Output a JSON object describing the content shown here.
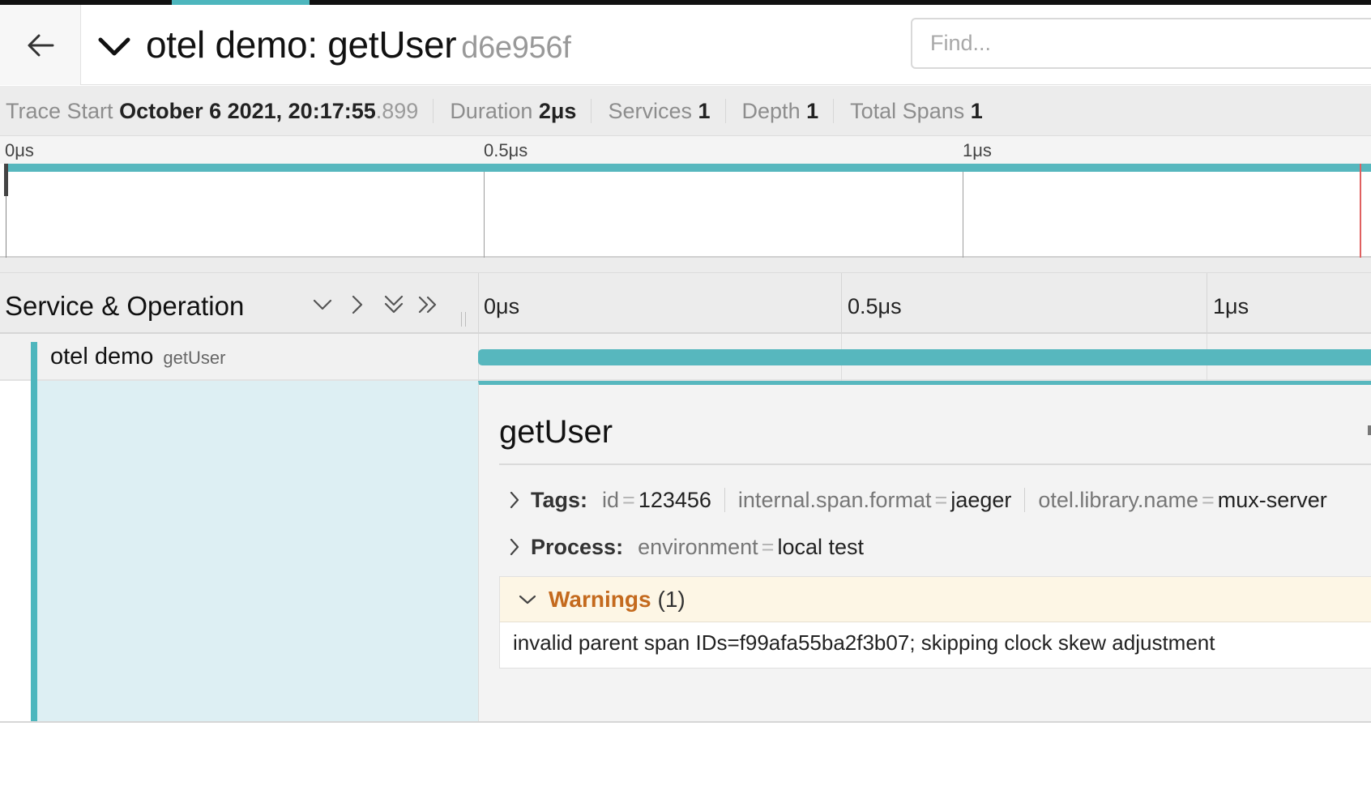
{
  "header": {
    "title": "otel demo: getUser",
    "trace_id": "d6e956f",
    "search_placeholder": "Find..."
  },
  "meta": {
    "trace_start_label": "Trace Start",
    "trace_start_value": "October 6 2021, 20:17:55",
    "trace_start_ms": ".899",
    "duration_label": "Duration",
    "duration_value": "2μs",
    "services_label": "Services",
    "services_value": "1",
    "depth_label": "Depth",
    "depth_value": "1",
    "total_spans_label": "Total Spans",
    "total_spans_value": "1"
  },
  "minimap": {
    "ticks": [
      "0μs",
      "0.5μs",
      "1μs"
    ]
  },
  "timeline": {
    "column_title": "Service & Operation",
    "ticks": [
      "0μs",
      "0.5μs",
      "1μs"
    ]
  },
  "span": {
    "service": "otel demo",
    "operation": "getUser"
  },
  "detail": {
    "operation": "getUser",
    "tags_label": "Tags:",
    "tags": [
      {
        "key": "id",
        "value": "123456"
      },
      {
        "key": "internal.span.format",
        "value": "jaeger"
      },
      {
        "key": "otel.library.name",
        "value": "mux-server"
      }
    ],
    "process_label": "Process:",
    "process": [
      {
        "key": "environment",
        "value": "local test"
      }
    ],
    "warnings_label": "Warnings",
    "warnings_count": "(1)",
    "warnings": [
      "invalid parent span IDs=f99afa55ba2f3b07; skipping clock skew adjustment"
    ]
  },
  "colors": {
    "accent": "#4db6bd",
    "span_bar": "#57b7be",
    "warning_title": "#c46a1e",
    "warning_bg": "#fdf6e5"
  }
}
